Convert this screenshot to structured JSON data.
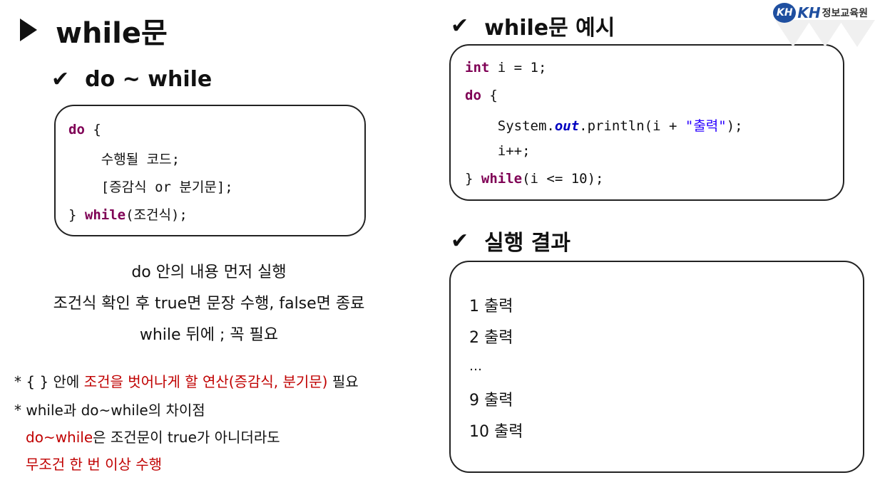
{
  "title": "while문",
  "left": {
    "heading": "do ~ while",
    "code": {
      "line1_kw": "do",
      "line1_rest": " {",
      "line2": "    수행될 코드;",
      "line3": "    [증감식 or 분기문];",
      "line4_pre": "} ",
      "line4_kw": "while",
      "line4_rest": "(조건식);"
    },
    "desc": [
      "do 안의 내용 먼저 실행",
      "조건식 확인 후 true면 문장 수행, false면 종료",
      "while 뒤에 ; 꼭 필요"
    ],
    "notes": {
      "n1_pre": "* { } 안에 ",
      "n1_red": "조건을 벗어나게 할 연산(증감식, 분기문)",
      "n1_post": " 필요",
      "n2": "* while과 do~while의 차이점",
      "n3_red": "do~while",
      "n3_post": "은 조건문이 true가 아니더라도",
      "n4_red": "무조건 한 번 이상 수행"
    }
  },
  "right": {
    "example_heading": "while문 예시",
    "code": {
      "l1_kw": "int",
      "l1_rest": " i = 1;",
      "l2_kw": "do",
      "l2_rest": " {",
      "l3_pre": "    System.",
      "l3_field": "out",
      "l3_mid": ".println(i + ",
      "l3_str": "\"출력\"",
      "l3_post": ");",
      "l4": "    i++;",
      "l5_pre": "} ",
      "l5_kw": "while",
      "l5_rest": "(i <= 10);"
    },
    "result_heading": "실행 결과",
    "results": [
      "1 출력",
      "2 출력",
      "…",
      "9 출력",
      "10 출력"
    ]
  },
  "logo": {
    "badge": "KH",
    "kh": "KH",
    "text": "정보교육원"
  },
  "colors": {
    "keyword": "#7f0055",
    "field": "#0000c0",
    "string": "#2a00ff",
    "emphasis_red": "#c00000",
    "brand_blue": "#1f4fa0"
  },
  "icons": [
    "play-arrow-icon",
    "checkmark-icon",
    "kh-logo-icon"
  ]
}
